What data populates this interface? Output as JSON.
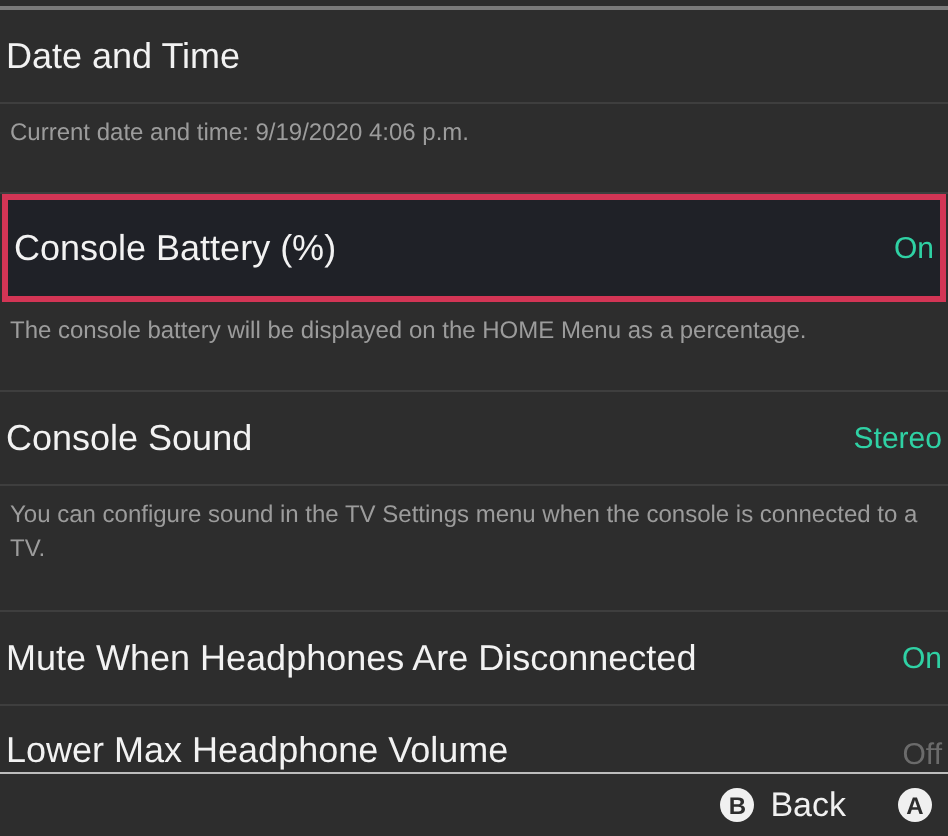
{
  "settings": [
    {
      "title": "Date and Time",
      "selected": false,
      "description": "Current date and time: 9/19/2020 4:06 p.m."
    },
    {
      "title": "Console Battery (%)",
      "value": "On",
      "value_on": true,
      "selected": true,
      "description": "The console battery will be displayed on the HOME Menu as a percentage."
    },
    {
      "title": "Console Sound",
      "value": "Stereo",
      "value_on": true,
      "selected": false,
      "description": "You can configure sound in the TV Settings menu when the console is connected to a TV."
    },
    {
      "title": "Mute When Headphones Are Disconnected",
      "value": "On",
      "value_on": true,
      "selected": false
    },
    {
      "title": "Lower Max Headphone Volume",
      "value": "Off",
      "value_on": false,
      "selected": false
    }
  ],
  "footer": [
    {
      "glyph": "B",
      "label": "Back"
    },
    {
      "glyph": "A"
    }
  ]
}
